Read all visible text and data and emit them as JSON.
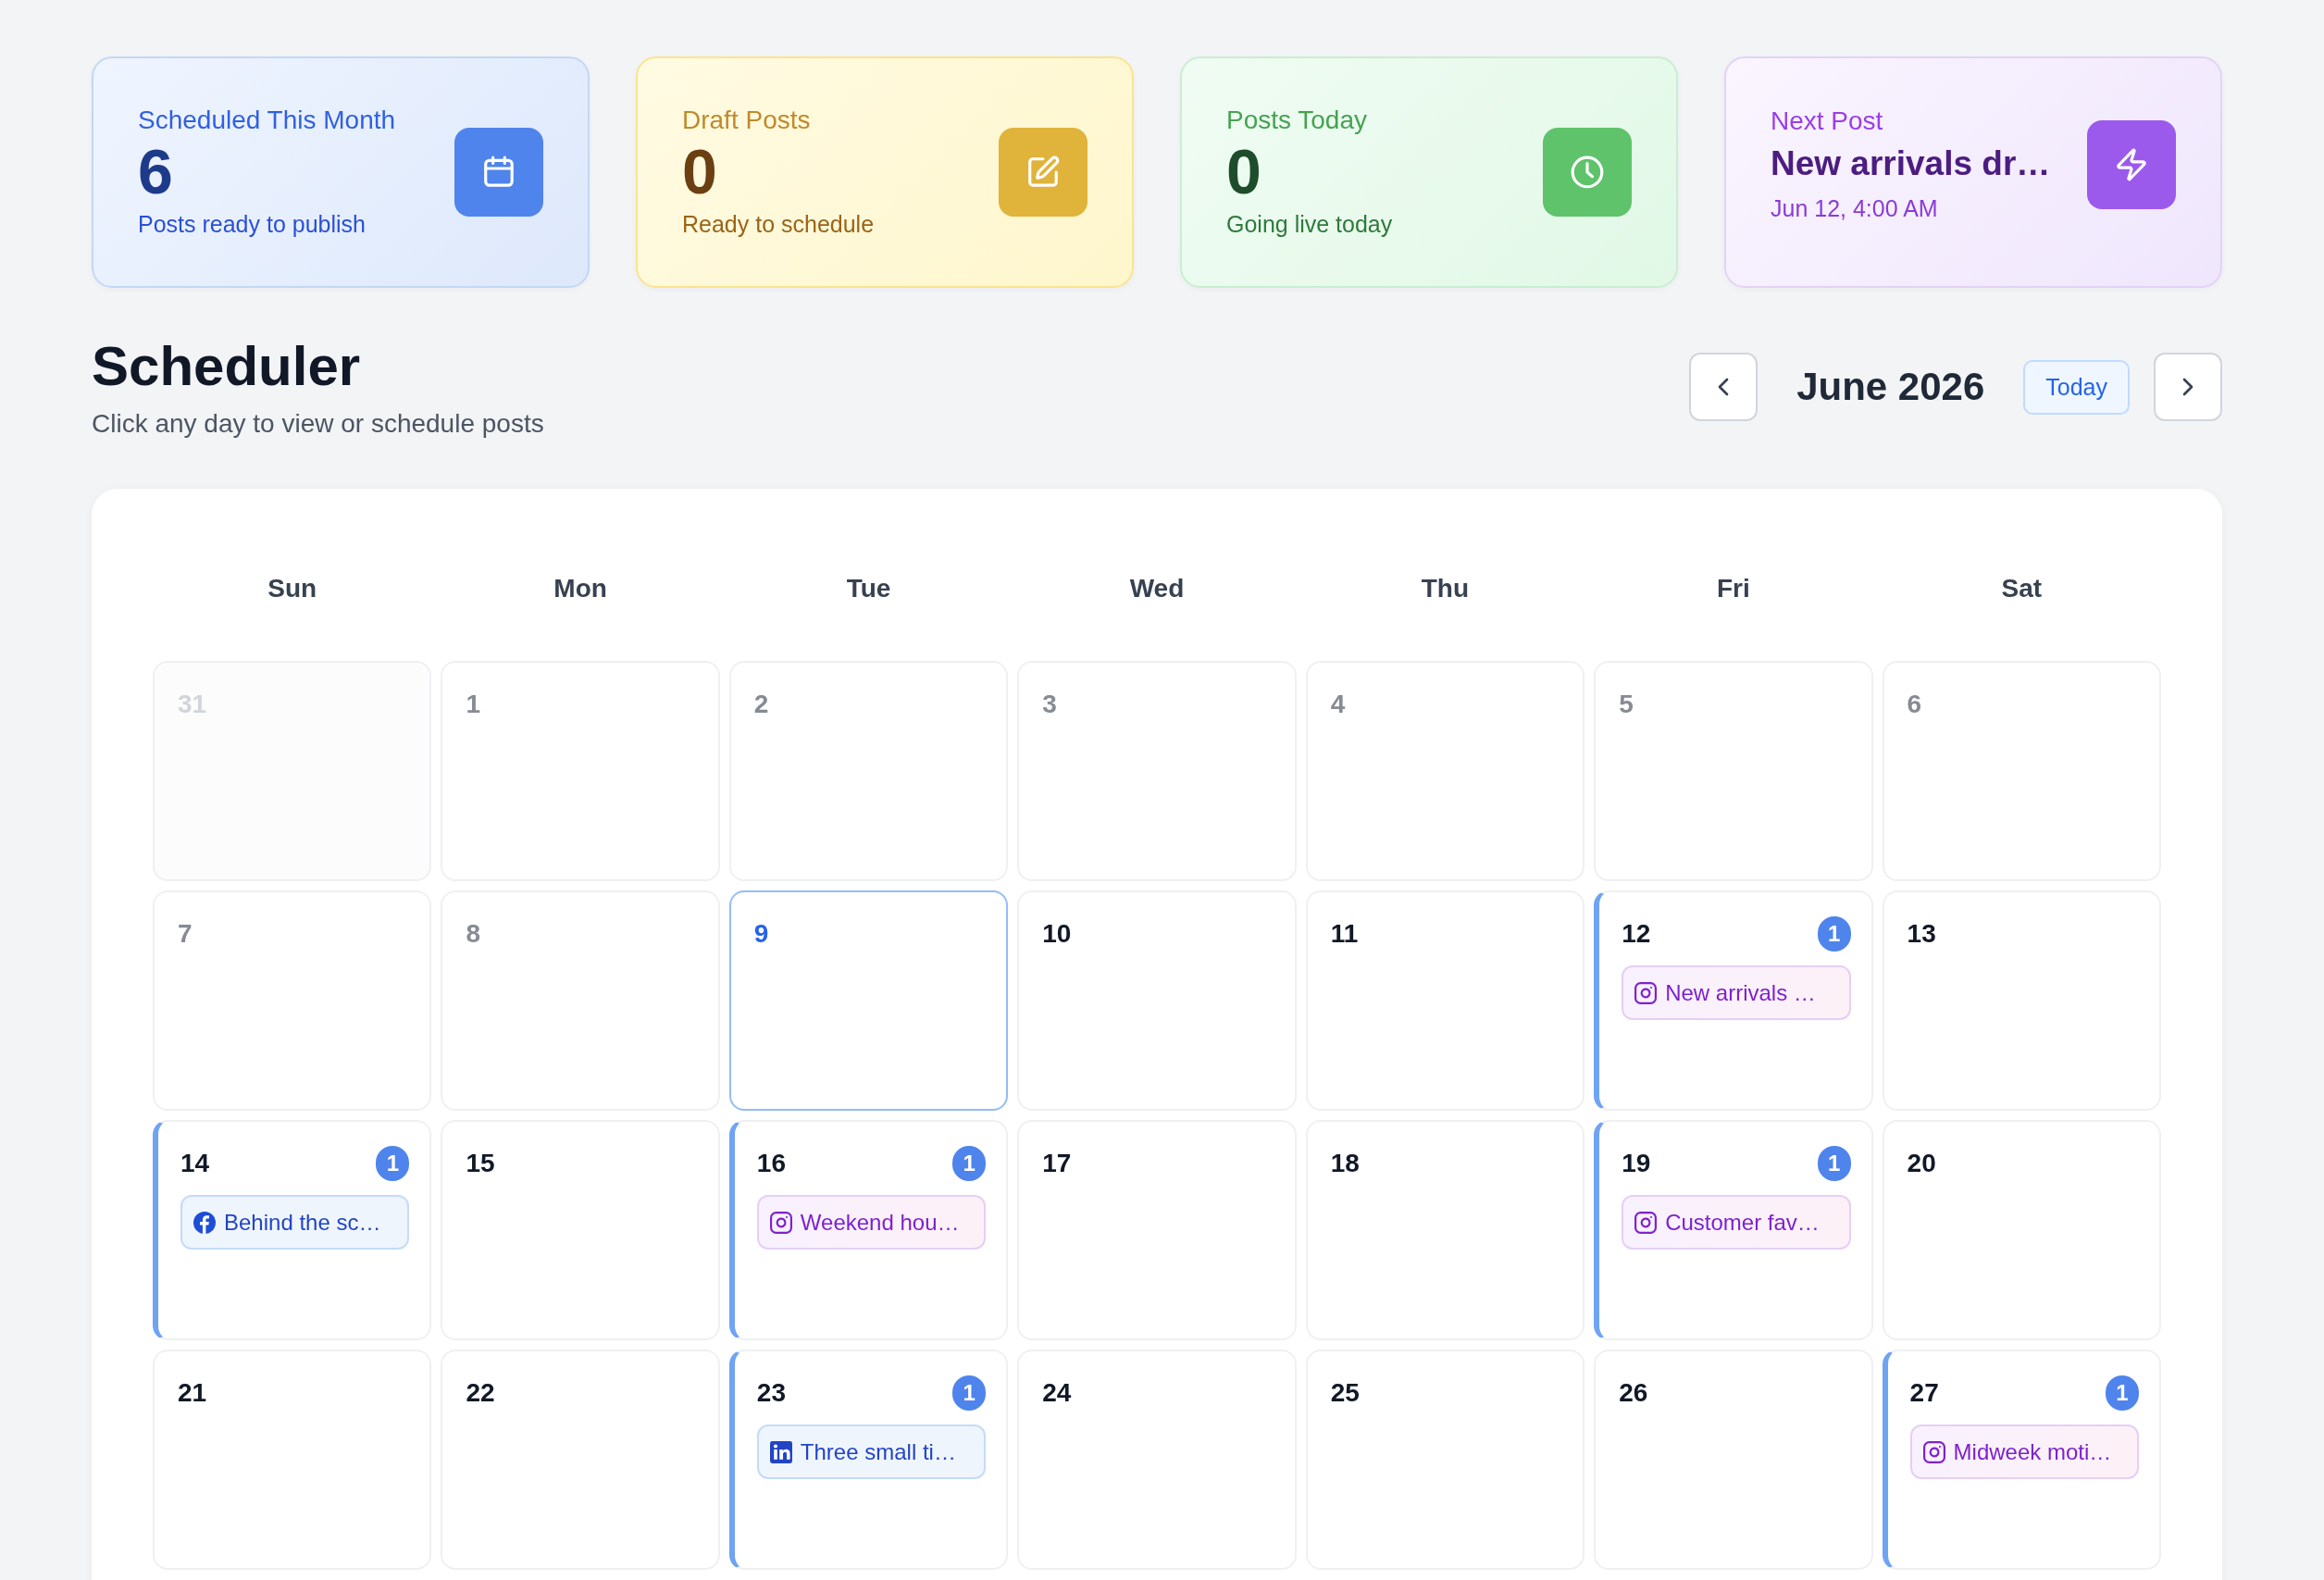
{
  "stats": [
    {
      "kind": "scheduled",
      "title": "Scheduled This Month",
      "value": "6",
      "caption": "Posts ready to publish"
    },
    {
      "kind": "drafts",
      "title": "Draft Posts",
      "value": "0",
      "caption": "Ready to schedule"
    },
    {
      "kind": "today",
      "title": "Posts Today",
      "value": "0",
      "caption": "Going live today"
    },
    {
      "kind": "next",
      "title": "Next Post",
      "value": "New arrivals dr…",
      "caption": "Jun 12, 4:00 AM"
    }
  ],
  "header": {
    "title": "Scheduler",
    "subtitle": "Click any day to view or schedule posts"
  },
  "navigation": {
    "month": "June 2026",
    "today_button": "Today"
  },
  "calendar": {
    "weekdays": [
      "Sun",
      "Mon",
      "Tue",
      "Wed",
      "Thu",
      "Fri",
      "Sat"
    ],
    "weeks": [
      [
        {
          "day": "31",
          "kind": "outside"
        },
        {
          "day": "1",
          "kind": "past"
        },
        {
          "day": "2",
          "kind": "past"
        },
        {
          "day": "3",
          "kind": "past"
        },
        {
          "day": "4",
          "kind": "past"
        },
        {
          "day": "5",
          "kind": "past"
        },
        {
          "day": "6",
          "kind": "past"
        }
      ],
      [
        {
          "day": "7",
          "kind": "past"
        },
        {
          "day": "8",
          "kind": "past"
        },
        {
          "day": "9",
          "kind": "today"
        },
        {
          "day": "10",
          "kind": "upcoming"
        },
        {
          "day": "11",
          "kind": "upcoming"
        },
        {
          "day": "12",
          "kind": "upcoming",
          "count": "1",
          "posts": [
            {
              "kind": "instagram",
              "title": "New arrivals …"
            }
          ]
        },
        {
          "day": "13",
          "kind": "upcoming"
        }
      ],
      [
        {
          "day": "14",
          "kind": "upcoming",
          "count": "1",
          "posts": [
            {
              "kind": "facebook",
              "title": "Behind the sc…"
            }
          ]
        },
        {
          "day": "15",
          "kind": "upcoming"
        },
        {
          "day": "16",
          "kind": "upcoming",
          "count": "1",
          "posts": [
            {
              "kind": "instagram",
              "title": "Weekend hou…"
            }
          ]
        },
        {
          "day": "17",
          "kind": "upcoming"
        },
        {
          "day": "18",
          "kind": "upcoming"
        },
        {
          "day": "19",
          "kind": "upcoming",
          "count": "1",
          "posts": [
            {
              "kind": "instagram",
              "title": "Customer fav…"
            }
          ]
        },
        {
          "day": "20",
          "kind": "upcoming"
        }
      ],
      [
        {
          "day": "21",
          "kind": "upcoming"
        },
        {
          "day": "22",
          "kind": "upcoming"
        },
        {
          "day": "23",
          "kind": "upcoming",
          "count": "1",
          "posts": [
            {
              "kind": "linkedin",
              "title": "Three small ti…"
            }
          ]
        },
        {
          "day": "24",
          "kind": "upcoming"
        },
        {
          "day": "25",
          "kind": "upcoming"
        },
        {
          "day": "26",
          "kind": "upcoming"
        },
        {
          "day": "27",
          "kind": "upcoming",
          "count": "1",
          "posts": [
            {
              "kind": "instagram",
              "title": "Midweek moti…"
            }
          ]
        }
      ]
    ]
  }
}
